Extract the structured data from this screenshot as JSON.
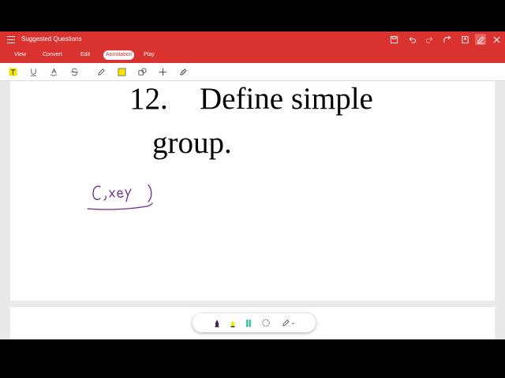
{
  "window": {
    "title": "Suggested Questions"
  },
  "tabs": [
    {
      "label": "View"
    },
    {
      "label": "Convert"
    },
    {
      "label": "Edit"
    },
    {
      "label": "Annotation",
      "active": true
    },
    {
      "label": "Play"
    }
  ],
  "annotation_tools": [
    "highlight-text-icon",
    "underline-icon",
    "squiggly-icon",
    "strikethrough-icon",
    "pencil-icon",
    "area-highlight-icon",
    "shapes-icon",
    "add-icon",
    "stamp-icon"
  ],
  "titlebar_tools": [
    "save-icon",
    "undo-icon",
    "redo-icon",
    "share-icon",
    "bookmark-icon",
    "edit-pen-icon",
    "close-icon"
  ],
  "document": {
    "question_number": "12.",
    "question_line1": "Define simple",
    "question_line2": "group.",
    "handwriting": "G, xey"
  },
  "colors": {
    "accent": "#d9322f",
    "pen_purple": "#6a2a8a",
    "highlight_yellow": "#f2e600"
  },
  "pen_toolbar": [
    "purple-pen-icon",
    "yellow-marker-icon",
    "teal-highlighter-icon",
    "lasso-icon",
    "pen-settings-icon"
  ]
}
